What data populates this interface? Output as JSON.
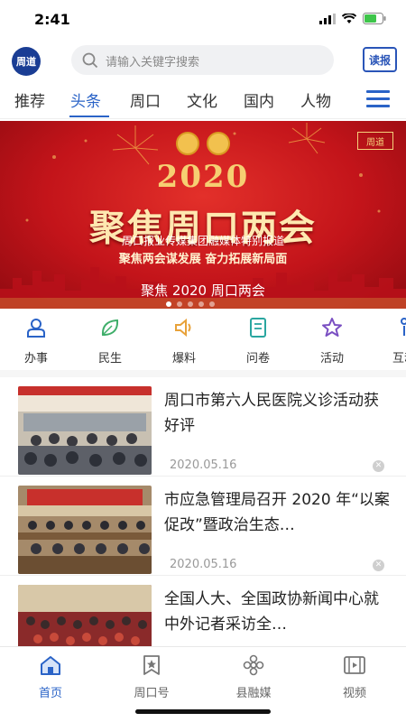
{
  "status": {
    "time": "2:41"
  },
  "header": {
    "logo_text": "周道",
    "search_placeholder": "请输入关键字搜索",
    "duobao_label": "读报"
  },
  "tabs": [
    {
      "label": "推荐",
      "active": false
    },
    {
      "label": "头条",
      "active": true
    },
    {
      "label": "周口",
      "active": false
    },
    {
      "label": "文化",
      "active": false
    },
    {
      "label": "国内",
      "active": false
    },
    {
      "label": "人物",
      "active": false
    }
  ],
  "banner": {
    "brand": "周道",
    "year": "2020",
    "headline": "聚焦周口两会",
    "sub1": "周口报业传媒集团融媒体特别报道",
    "sub2": "聚焦两会谋发展  奋力拓展新局面",
    "caption": "聚焦 2020 周口两会",
    "slide_count": 5,
    "active_slide": 1
  },
  "quick_entries": [
    {
      "label": "办事",
      "icon": "user-badge-icon",
      "color": "#2a63c7"
    },
    {
      "label": "民生",
      "icon": "leaf-icon",
      "color": "#3fae6a"
    },
    {
      "label": "爆料",
      "icon": "speaker-icon",
      "color": "#e8a23a"
    },
    {
      "label": "问卷",
      "icon": "form-icon",
      "color": "#2aa6a0"
    },
    {
      "label": "活动",
      "icon": "star-icon",
      "color": "#7a4fc2"
    },
    {
      "label": "互动",
      "icon": "person-icon",
      "color": "#2a63c7"
    }
  ],
  "news": [
    {
      "title": "周口市第六人民医院义诊活动获好评",
      "date": "2020.05.16",
      "thumb": "outdoor-clinic-photo"
    },
    {
      "title": "市应急管理局召开 2020 年“以案促改”暨政治生态…",
      "date": "2020.05.16",
      "thumb": "meeting-hall-photo"
    },
    {
      "title": "全国人大、全国政协新闻中心就中外记者采访全…",
      "date": "",
      "thumb": "press-crowd-photo"
    }
  ],
  "bottom_nav": [
    {
      "label": "首页",
      "icon": "home-icon",
      "active": true
    },
    {
      "label": "周口号",
      "icon": "bookmark-star-icon",
      "active": false
    },
    {
      "label": "县融媒",
      "icon": "flower-icon",
      "active": false
    },
    {
      "label": "视频",
      "icon": "film-icon",
      "active": false
    }
  ],
  "colors": {
    "accent": "#2a63c7",
    "banner_red": "#c3141a",
    "banner_gold": "#f6cf72"
  }
}
